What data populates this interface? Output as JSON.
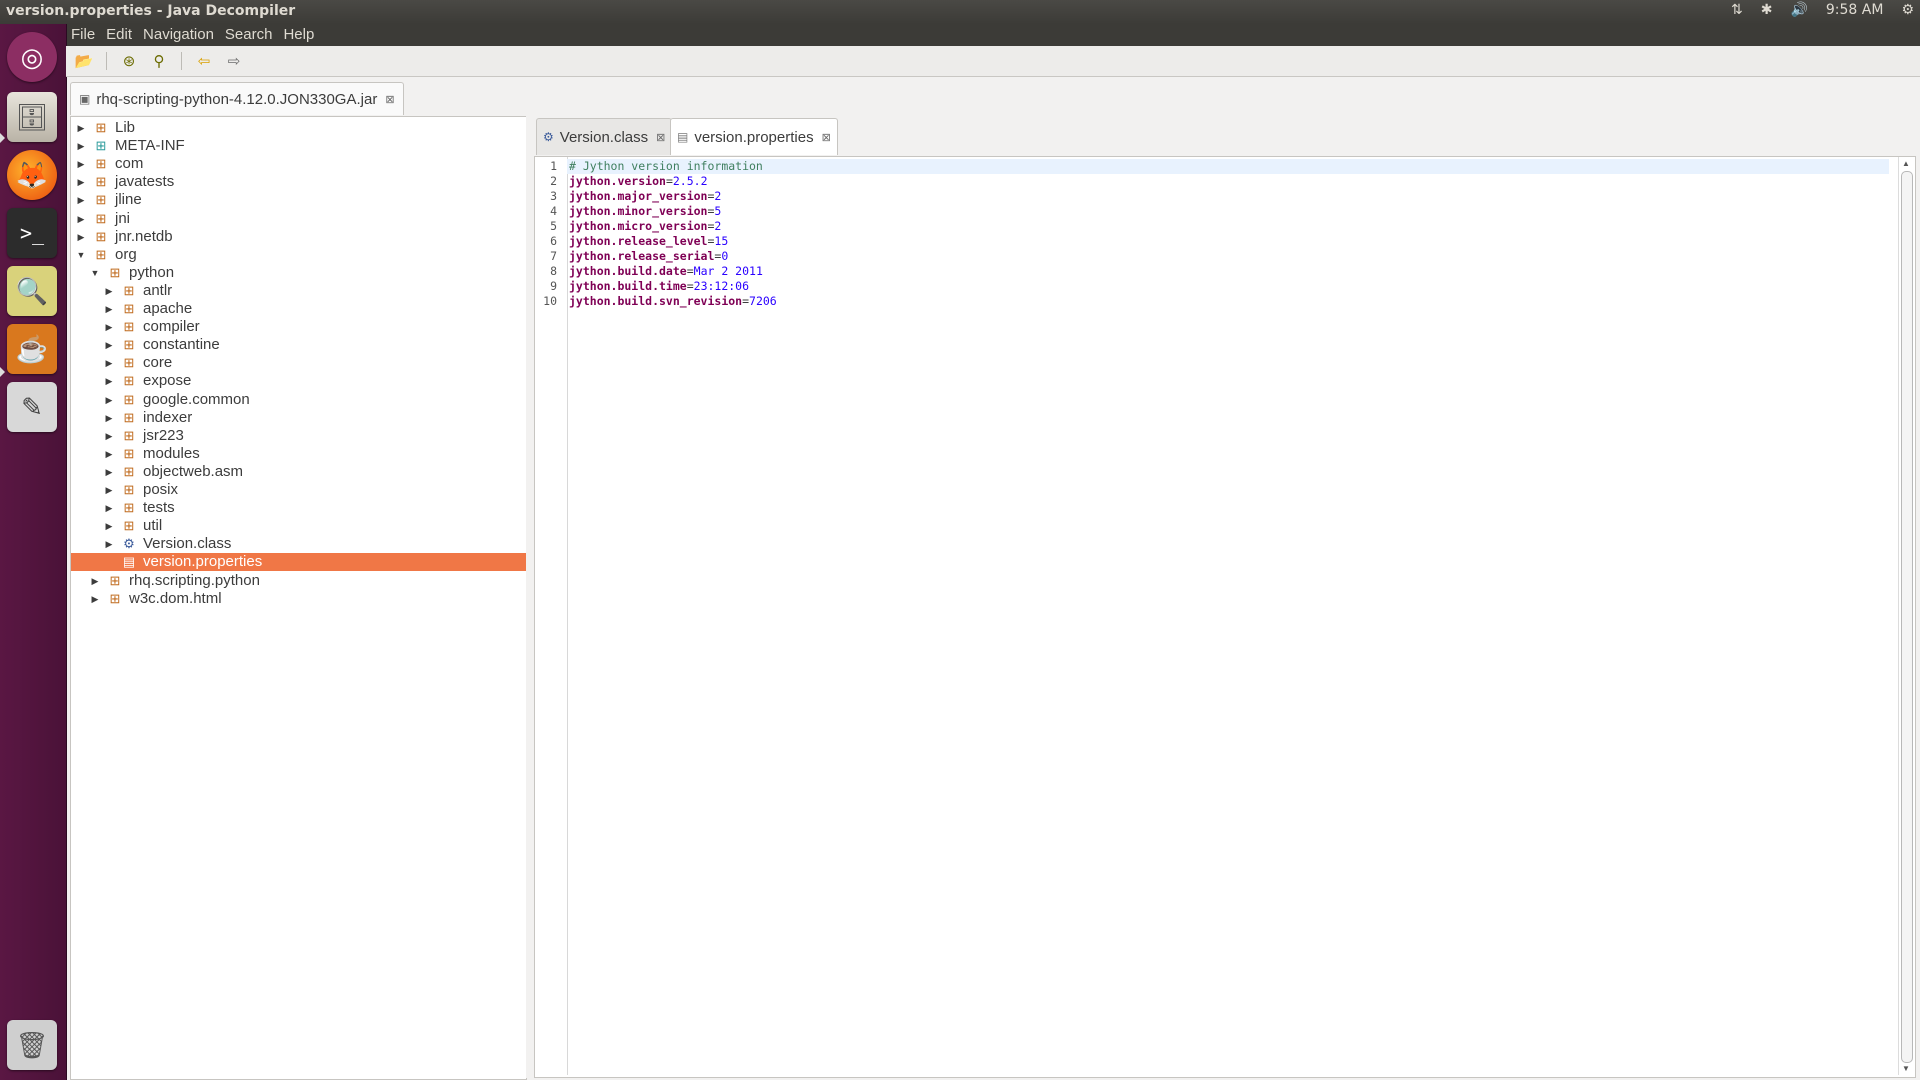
{
  "window": {
    "title": "version.properties - Java Decompiler"
  },
  "indicators": {
    "network": "⇅",
    "bluetooth": "✱",
    "volume": "🔊",
    "clock": "9:58 AM",
    "settings": "⚙"
  },
  "menu": [
    "File",
    "Edit",
    "Navigation",
    "Search",
    "Help"
  ],
  "launcher": [
    "ubuntu-dash-icon",
    "files-icon",
    "firefox-icon",
    "terminal-icon",
    "image-viewer-icon",
    "java-decompiler-icon",
    "text-editor-icon",
    "trash-icon"
  ],
  "toolbar": [
    "open-file-icon",
    "open-type-icon",
    "search-icon",
    "back-icon",
    "forward-icon"
  ],
  "jar_tab": {
    "label": "rhq-scripting-python-4.12.0.JON330GA.jar"
  },
  "tree": [
    {
      "label": "Lib",
      "depth": 0,
      "arrow": "right",
      "icon": "package"
    },
    {
      "label": "META-INF",
      "depth": 0,
      "arrow": "right",
      "icon": "meta"
    },
    {
      "label": "com",
      "depth": 0,
      "arrow": "right",
      "icon": "package"
    },
    {
      "label": "javatests",
      "depth": 0,
      "arrow": "right",
      "icon": "package"
    },
    {
      "label": "jline",
      "depth": 0,
      "arrow": "right",
      "icon": "package"
    },
    {
      "label": "jni",
      "depth": 0,
      "arrow": "right",
      "icon": "package"
    },
    {
      "label": "jnr.netdb",
      "depth": 0,
      "arrow": "right",
      "icon": "package"
    },
    {
      "label": "org",
      "depth": 0,
      "arrow": "down",
      "icon": "package"
    },
    {
      "label": "python",
      "depth": 1,
      "arrow": "down",
      "icon": "package"
    },
    {
      "label": "antlr",
      "depth": 2,
      "arrow": "right",
      "icon": "package"
    },
    {
      "label": "apache",
      "depth": 2,
      "arrow": "right",
      "icon": "package"
    },
    {
      "label": "compiler",
      "depth": 2,
      "arrow": "right",
      "icon": "package"
    },
    {
      "label": "constantine",
      "depth": 2,
      "arrow": "right",
      "icon": "package"
    },
    {
      "label": "core",
      "depth": 2,
      "arrow": "right",
      "icon": "package"
    },
    {
      "label": "expose",
      "depth": 2,
      "arrow": "right",
      "icon": "package"
    },
    {
      "label": "google.common",
      "depth": 2,
      "arrow": "right",
      "icon": "package"
    },
    {
      "label": "indexer",
      "depth": 2,
      "arrow": "right",
      "icon": "package"
    },
    {
      "label": "jsr223",
      "depth": 2,
      "arrow": "right",
      "icon": "package"
    },
    {
      "label": "modules",
      "depth": 2,
      "arrow": "right",
      "icon": "package"
    },
    {
      "label": "objectweb.asm",
      "depth": 2,
      "arrow": "right",
      "icon": "package"
    },
    {
      "label": "posix",
      "depth": 2,
      "arrow": "right",
      "icon": "package"
    },
    {
      "label": "tests",
      "depth": 2,
      "arrow": "right",
      "icon": "package"
    },
    {
      "label": "util",
      "depth": 2,
      "arrow": "right",
      "icon": "package"
    },
    {
      "label": "Version.class",
      "depth": 2,
      "arrow": "right",
      "icon": "class"
    },
    {
      "label": "version.properties",
      "depth": 2,
      "arrow": "none",
      "icon": "file",
      "selected": true
    },
    {
      "label": "rhq.scripting.python",
      "depth": 1,
      "arrow": "right",
      "icon": "package"
    },
    {
      "label": "w3c.dom.html",
      "depth": 1,
      "arrow": "right",
      "icon": "package"
    }
  ],
  "editor_tabs": [
    {
      "label": "Version.class",
      "icon": "class",
      "active": false
    },
    {
      "label": "version.properties",
      "icon": "file",
      "active": true
    }
  ],
  "code": [
    {
      "key": "# Jython version information",
      "value": "",
      "comment": true
    },
    {
      "key": "jython.version",
      "value": "2.5.2"
    },
    {
      "key": "jython.major_version",
      "value": "2"
    },
    {
      "key": "jython.minor_version",
      "value": "5"
    },
    {
      "key": "jython.micro_version",
      "value": "2"
    },
    {
      "key": "jython.release_level",
      "value": "15"
    },
    {
      "key": "jython.release_serial",
      "value": "0"
    },
    {
      "key": "jython.build.date",
      "value": "Mar 2 2011"
    },
    {
      "key": "jython.build.time",
      "value": "23:12:06"
    },
    {
      "key": "jython.build.svn_revision",
      "value": "7206"
    }
  ],
  "colors": {
    "selection": "#f07746",
    "launcher": "#5a1743",
    "keyword": "#7f0055",
    "value": "#2a00ff",
    "comment": "#3f7f5f"
  }
}
